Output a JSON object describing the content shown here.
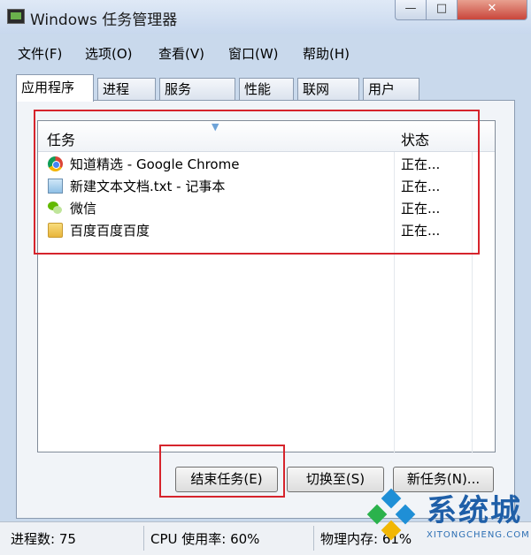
{
  "window": {
    "title": "Windows 任务管理器",
    "controls": {
      "minimize": "—",
      "maximize": "□",
      "close": "✕"
    }
  },
  "menu": [
    "文件(F)",
    "选项(O)",
    "查看(V)",
    "窗口(W)",
    "帮助(H)"
  ],
  "tabs": [
    "应用程序",
    "进程",
    "服务",
    "性能",
    "联网",
    "用户"
  ],
  "active_tab": "应用程序",
  "table": {
    "columns": [
      "任务",
      "状态"
    ],
    "rows": [
      {
        "name": "知道精选 - Google Chrome",
        "status": "正在...",
        "icon": "chrome-icon"
      },
      {
        "name": "新建文本文档.txt - 记事本",
        "status": "正在...",
        "icon": "notepad-icon"
      },
      {
        "name": "微信",
        "status": "正在...",
        "icon": "wechat-icon"
      },
      {
        "name": "百度百度百度",
        "status": "正在...",
        "icon": "folder-icon"
      }
    ]
  },
  "buttons": {
    "end_task": "结束任务(E)",
    "switch_to": "切换至(S)",
    "new_task": "新任务(N)..."
  },
  "status": {
    "processes": "进程数: 75",
    "cpu": "CPU 使用率: 60%",
    "memory": "物理内存: 61%"
  },
  "watermark": {
    "brand": "系统城",
    "site": "XITONGCHENG.COM"
  },
  "colors": {
    "highlight": "#d6242c",
    "title_bg": "#c8d8ee",
    "close_button": "#c9463a"
  }
}
